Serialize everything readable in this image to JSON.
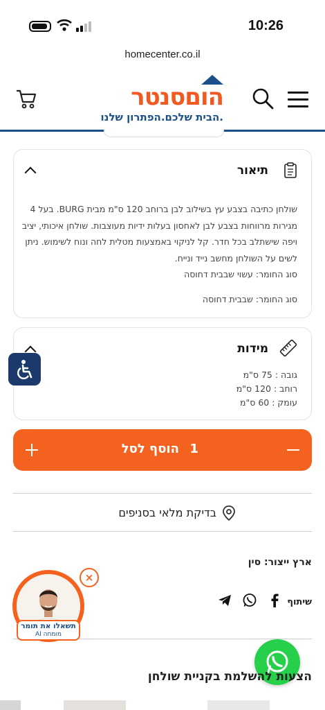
{
  "status_bar": {
    "time": "10:26"
  },
  "browser": {
    "url": "homecenter.co.il"
  },
  "header": {
    "logo_text": "הוםסנטר",
    "logo_tagline": "הבית שלכם.הפתרון שלנו."
  },
  "description": {
    "title": "תיאור",
    "paragraphs": [
      "שולחן כתיבה בצבע עץ בשילוב לבן ברוחב 120 ס\"מ מבית BURG. בעל 4 מגירות מרווחות בצבע לבן לאחסון בעלות ידיות מעוצבות. שולחן איכותי, יציב ויפה שישתלב בכל חדר. קל לניקוי באמצעות מטלית לחה ונוח לשימוש. ניתן לשים על השולחן מחשב נייד ונייח.",
      "סוג החומר: עשוי שבבית דחוסה"
    ],
    "material": "סוג החומר: שבבית דחוסה"
  },
  "dimensions": {
    "title": "מידות",
    "items": [
      "גובה : 75 ס\"מ",
      "רוחב : 120 ס\"מ",
      "עומק : 60 ס\"מ"
    ]
  },
  "cart": {
    "quantity": "1",
    "add_label": "הוסף לסל"
  },
  "stock": {
    "label": "בדיקת מלאי בסניפים"
  },
  "origin": "ארץ ייצור: סין",
  "share": {
    "label": "שיתוף"
  },
  "ai_expert": {
    "title": "תשאלו את תומר",
    "subtitle": "AI מומחה"
  },
  "close_symbol": "×",
  "complete_title": "הצעות להשלמת בקניית שולחן",
  "colors": {
    "brand_orange": "#f4621f",
    "brand_blue": "#1b4f8a",
    "whatsapp": "#27d04a"
  }
}
